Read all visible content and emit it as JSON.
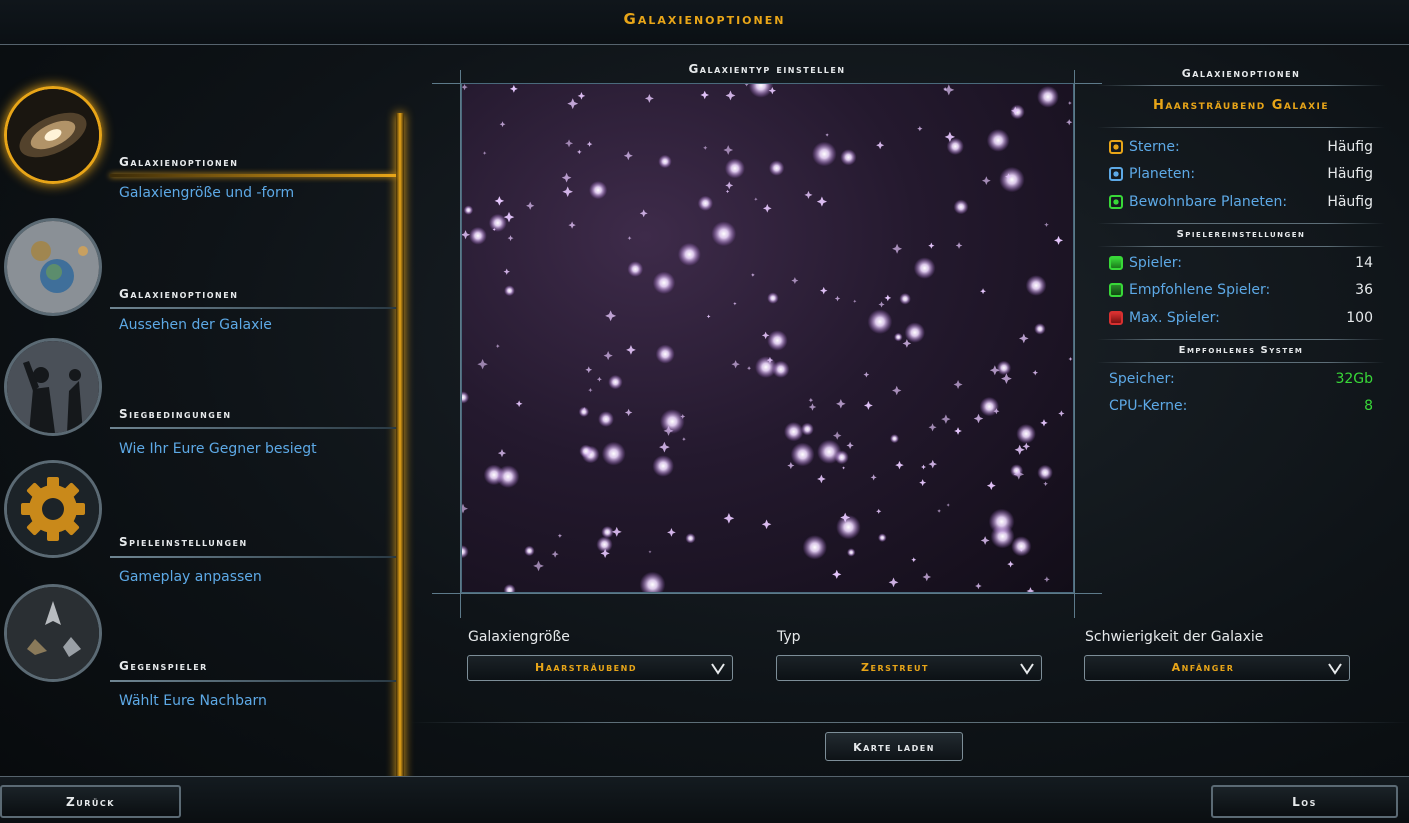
{
  "header": {
    "title": "Galaxienoptionen"
  },
  "nav": {
    "items": [
      {
        "title": "Galaxienoptionen",
        "subtitle": "Galaxiengröße und -form",
        "icon": "spiral-galaxy-icon",
        "active": true
      },
      {
        "title": "Galaxienoptionen",
        "subtitle": "Aussehen der Galaxie",
        "icon": "planets-icon",
        "active": false
      },
      {
        "title": "Siegbedingungen",
        "subtitle": "Wie Ihr Eure Gegner besiegt",
        "icon": "soldier-silhouette-icon",
        "active": false
      },
      {
        "title": "Spieleinstellungen",
        "subtitle": "Gameplay anpassen",
        "icon": "gear-icon",
        "active": false
      },
      {
        "title": "Gegenspieler",
        "subtitle": "Wählt Eure Nachbarn",
        "icon": "spaceships-icon",
        "active": false
      }
    ]
  },
  "center": {
    "title": "Galaxientyp einstellen",
    "dropdowns": [
      {
        "label": "Galaxiengröße",
        "value": "Haarsträubend"
      },
      {
        "label": "Typ",
        "value": "Zerstreut"
      },
      {
        "label": "Schwierigkeit der Galaxie",
        "value": "Anfänger"
      }
    ],
    "load_map": "Karte laden"
  },
  "right": {
    "title": "Galaxienoptionen",
    "galaxy_name": "Haarsträubend Galaxie",
    "galaxy_rows": [
      {
        "label": "Sterne:",
        "value": "Häufig",
        "icon": "star-icon",
        "color": "#e8a518"
      },
      {
        "label": "Planeten:",
        "value": "Häufig",
        "icon": "planet-icon",
        "color": "#5da9e6"
      },
      {
        "label": "Bewohnbare Planeten:",
        "value": "Häufig",
        "icon": "habitable-planet-icon",
        "color": "#38d838"
      }
    ],
    "players_title": "Spielereinstellungen",
    "player_rows": [
      {
        "label": "Spieler:",
        "value": "14",
        "icon": "player-icon",
        "color": "#38d838"
      },
      {
        "label": "Empfohlene Spieler:",
        "value": "36",
        "icon": "recommended-players-icon",
        "color": "#38d838"
      },
      {
        "label": "Max. Spieler:",
        "value": "100",
        "icon": "max-players-icon",
        "color": "#d83030"
      }
    ],
    "system_title": "Empfohlenes System",
    "system_rows": [
      {
        "label": "Speicher:",
        "value": "32Gb"
      },
      {
        "label": "CPU-Kerne:",
        "value": "8"
      }
    ]
  },
  "footer": {
    "back": "Zurück",
    "go": "Los"
  },
  "colors": {
    "accent": "#e8a518",
    "link": "#5da9e6",
    "good": "#38d838"
  }
}
